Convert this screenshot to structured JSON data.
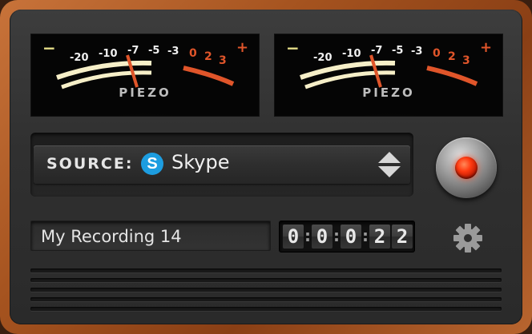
{
  "meters": [
    {
      "minus": "−",
      "plus": "+",
      "scale_labels": [
        "-20",
        "-10",
        "-7",
        "-5",
        "-3"
      ],
      "red_labels": [
        "0",
        "2",
        "3"
      ],
      "brand": "PIEZO"
    },
    {
      "minus": "−",
      "plus": "+",
      "scale_labels": [
        "-20",
        "-10",
        "-7",
        "-5",
        "-3"
      ],
      "red_labels": [
        "0",
        "2",
        "3"
      ],
      "brand": "PIEZO"
    }
  ],
  "source": {
    "label": "SOURCE:",
    "icon": "skype-icon",
    "icon_glyph": "S",
    "value": "Skype"
  },
  "record_button": {
    "icon": "record-light-icon"
  },
  "recording_name": "My Recording 14",
  "timer": {
    "digits": [
      "0",
      "0",
      "0",
      "2",
      "2"
    ],
    "separator": ":"
  },
  "settings_icon": "gear-icon",
  "colors": {
    "accent_red": "#ff3a10",
    "skype_blue": "#1d9de0",
    "wood": "#a5531f",
    "needle": "#e0552a"
  }
}
